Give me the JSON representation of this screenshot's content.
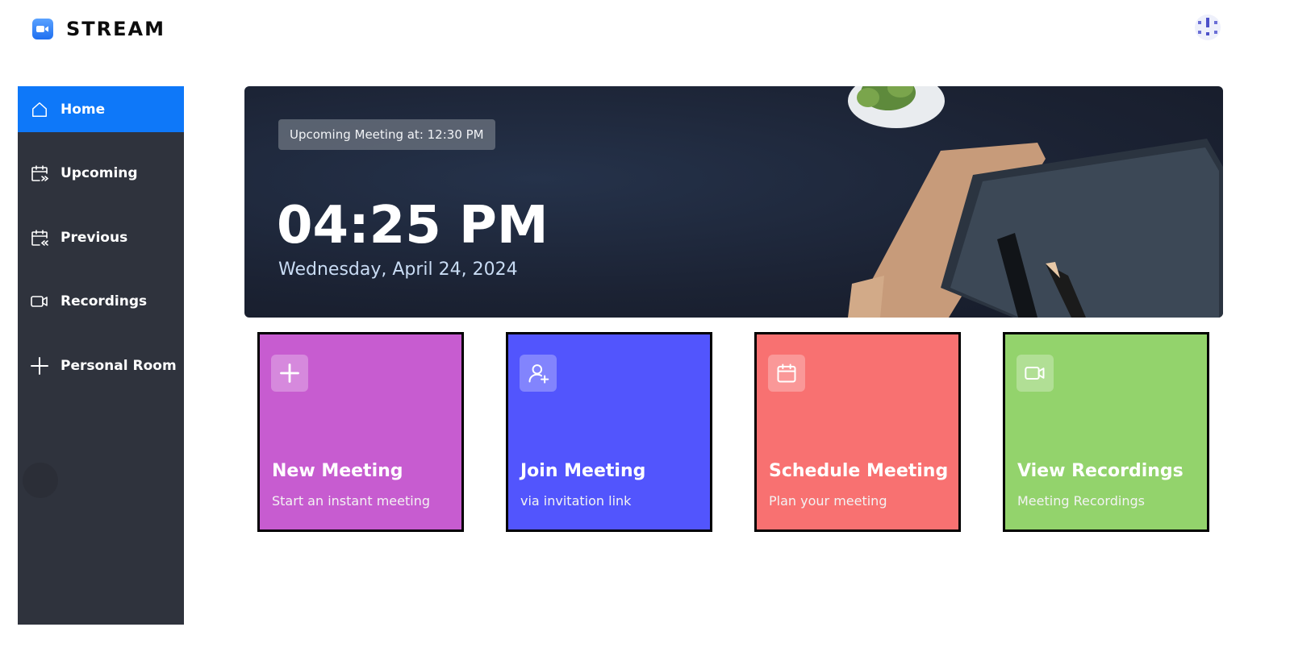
{
  "app": {
    "name": "STREAM"
  },
  "sidebar": {
    "items": [
      {
        "label": "Home",
        "icon": "home-icon",
        "active": true
      },
      {
        "label": "Upcoming",
        "icon": "calendar-forward-icon",
        "active": false
      },
      {
        "label": "Previous",
        "icon": "calendar-back-icon",
        "active": false
      },
      {
        "label": "Recordings",
        "icon": "video-icon",
        "active": false
      },
      {
        "label": "Personal Room",
        "icon": "plus-icon",
        "active": false
      }
    ]
  },
  "hero": {
    "badge": "Upcoming Meeting at: 12:30 PM",
    "time": "04:25 PM",
    "date": "Wednesday, April 24, 2024"
  },
  "cards": [
    {
      "title": "New Meeting",
      "subtitle": "Start an instant meeting",
      "icon": "plus-icon",
      "color": "#c75cd0"
    },
    {
      "title": "Join Meeting",
      "subtitle": "via invitation link",
      "icon": "user-plus-icon",
      "color": "#5255fd"
    },
    {
      "title": "Schedule Meeting",
      "subtitle": "Plan your meeting",
      "icon": "calendar-icon",
      "color": "#f87171"
    },
    {
      "title": "View Recordings",
      "subtitle": "Meeting Recordings",
      "icon": "video-icon",
      "color": "#93d36c"
    }
  ],
  "colors": {
    "sidebar_bg": "#2f333d",
    "active_item": "#0e78f9",
    "hero_bg": "#1b2233"
  }
}
